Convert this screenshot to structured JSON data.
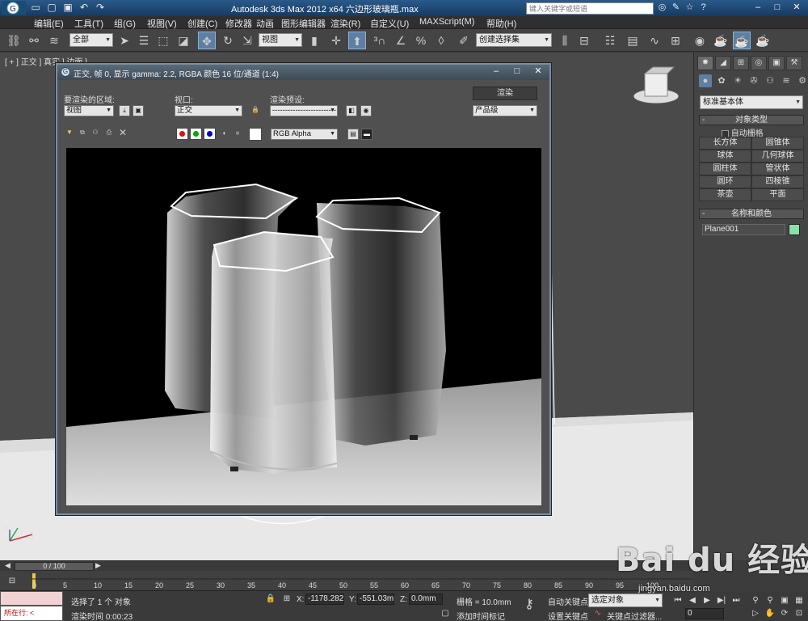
{
  "title_bar": {
    "app_title": "Autodesk 3ds Max  2012 x64      六边形玻璃瓶.max",
    "search_placeholder": "键入关键字或短语",
    "quick_access": [
      "new-icon",
      "open-icon",
      "save-icon",
      "undo-icon",
      "redo-icon"
    ],
    "window_buttons": [
      "–",
      "□",
      "✕"
    ]
  },
  "menu": [
    "编辑(E)",
    "工具(T)",
    "组(G)",
    "视图(V)",
    "创建(C)",
    "修改器",
    "动画",
    "图形编辑器",
    "渲染(R)",
    "自定义(U)",
    "MAXScript(M)",
    "帮助(H)"
  ],
  "toolbar": {
    "selection_filter": "全部",
    "ref_coord": "视图",
    "named_selection": "创建选择集"
  },
  "viewport": {
    "label": "[ + ] 正交 ] 真实 ] 边面 ]"
  },
  "render_window": {
    "title": "正交, 帧 0, 显示 gamma: 2.2, RGBA 颜色 16 位/通道 (1:4)",
    "area_label": "要渲染的区域:",
    "area_value": "视图",
    "viewport_label": "视口:",
    "viewport_value": "正交",
    "preset_label": "渲染预设:",
    "preset_value": "-------------------------",
    "render_button": "渲染",
    "quality_value": "产品级",
    "channel_value": "RGB Alpha",
    "colors": {
      "red": "#d11",
      "green": "#0a0",
      "blue": "#00c"
    }
  },
  "command_panel": {
    "category": "标准基本体",
    "rollout_object_type": "对象类型",
    "auto_grid": "自动栅格",
    "primitives": [
      "长方体",
      "圆锥体",
      "球体",
      "几何球体",
      "圆柱体",
      "管状体",
      "圆环",
      "四棱锥",
      "茶壶",
      "平面"
    ],
    "rollout_name_color": "名称和颜色",
    "object_name": "Plane001",
    "object_color": "#88e0a8"
  },
  "timeline": {
    "frame_display": "0 / 100",
    "ticks": [
      "0",
      "5",
      "10",
      "15",
      "20",
      "25",
      "30",
      "35",
      "40",
      "45",
      "50",
      "55",
      "60",
      "65",
      "70",
      "75",
      "80",
      "85",
      "90",
      "95",
      "100"
    ]
  },
  "status": {
    "selection_msg": "选择了 1 个 对象",
    "render_time": "渲染时间 0:00:23",
    "maxscript_label": "所在行:",
    "x_label": "X:",
    "x_value": "-1178.282",
    "y_label": "Y:",
    "y_value": "-551.03mm",
    "z_label": "Z:",
    "z_value": "0.0mm",
    "grid": "栅格 = 10.0mm",
    "add_time_tag": "添加时间标记",
    "auto_key": "自动关键点",
    "set_key": "设置关键点",
    "key_mode": "选定对象",
    "key_filters": "关键点过滤器...",
    "frame": "0"
  },
  "watermark": {
    "logo": "Bai du 经验",
    "url": "jingyan.baidu.com"
  }
}
